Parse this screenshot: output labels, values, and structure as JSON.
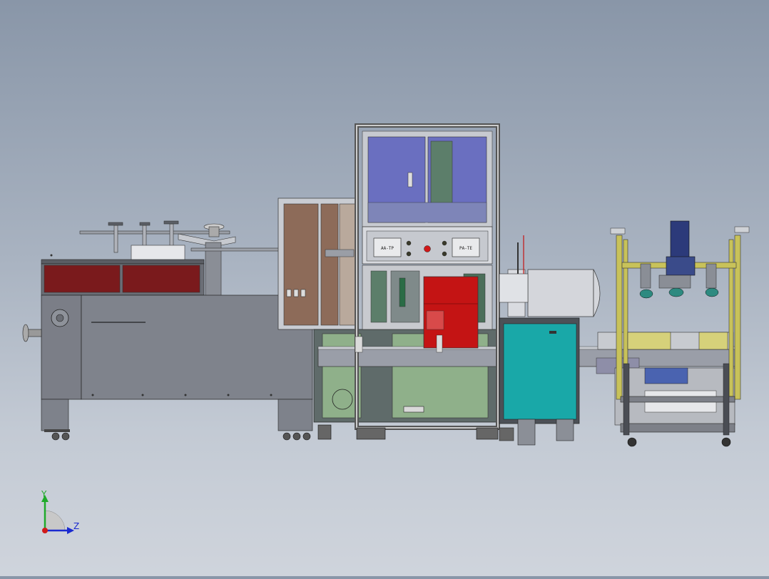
{
  "viewport": {
    "description_icon": "cad-3d-assembly-view",
    "background_top": "#8996a8",
    "background_bottom": "#cfd4dc"
  },
  "machine": {
    "left_unit_color": "#7a7d86",
    "window_color": "#7a1a1c",
    "cabinet_frame_color": "#c9ccd2",
    "glass_color": "#6a6fc0",
    "red_box_color": "#c41414",
    "teal_cabinet_color": "#19a8a8",
    "green_panel_color": "#8fb08a",
    "yellow_frame_color": "#c8c25a",
    "control_panel": {
      "left_display": "AA-TP",
      "right_display": "PA-TE"
    }
  },
  "triad": {
    "x_label": "",
    "y_label": "Y",
    "z_label": "Z",
    "y_color": "#1faa2a",
    "z_color": "#1a2ad0",
    "x_color": "#d01a1a"
  }
}
